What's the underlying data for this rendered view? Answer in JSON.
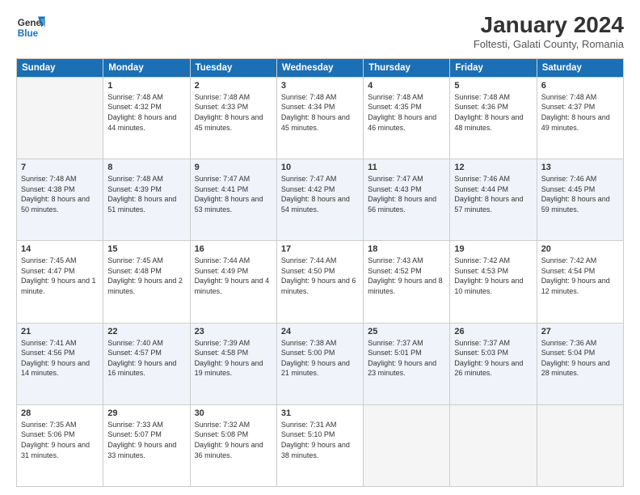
{
  "logo": {
    "line1": "General",
    "line2": "Blue"
  },
  "title": "January 2024",
  "subtitle": "Foltesti, Galati County, Romania",
  "header": {
    "days": [
      "Sunday",
      "Monday",
      "Tuesday",
      "Wednesday",
      "Thursday",
      "Friday",
      "Saturday"
    ]
  },
  "weeks": [
    [
      {
        "num": "",
        "empty": true
      },
      {
        "num": "1",
        "sunrise": "7:48 AM",
        "sunset": "4:32 PM",
        "daylight": "8 hours and 44 minutes."
      },
      {
        "num": "2",
        "sunrise": "7:48 AM",
        "sunset": "4:33 PM",
        "daylight": "8 hours and 45 minutes."
      },
      {
        "num": "3",
        "sunrise": "7:48 AM",
        "sunset": "4:34 PM",
        "daylight": "8 hours and 45 minutes."
      },
      {
        "num": "4",
        "sunrise": "7:48 AM",
        "sunset": "4:35 PM",
        "daylight": "8 hours and 46 minutes."
      },
      {
        "num": "5",
        "sunrise": "7:48 AM",
        "sunset": "4:36 PM",
        "daylight": "8 hours and 48 minutes."
      },
      {
        "num": "6",
        "sunrise": "7:48 AM",
        "sunset": "4:37 PM",
        "daylight": "8 hours and 49 minutes."
      }
    ],
    [
      {
        "num": "7",
        "sunrise": "7:48 AM",
        "sunset": "4:38 PM",
        "daylight": "8 hours and 50 minutes."
      },
      {
        "num": "8",
        "sunrise": "7:48 AM",
        "sunset": "4:39 PM",
        "daylight": "8 hours and 51 minutes."
      },
      {
        "num": "9",
        "sunrise": "7:47 AM",
        "sunset": "4:41 PM",
        "daylight": "8 hours and 53 minutes."
      },
      {
        "num": "10",
        "sunrise": "7:47 AM",
        "sunset": "4:42 PM",
        "daylight": "8 hours and 54 minutes."
      },
      {
        "num": "11",
        "sunrise": "7:47 AM",
        "sunset": "4:43 PM",
        "daylight": "8 hours and 56 minutes."
      },
      {
        "num": "12",
        "sunrise": "7:46 AM",
        "sunset": "4:44 PM",
        "daylight": "8 hours and 57 minutes."
      },
      {
        "num": "13",
        "sunrise": "7:46 AM",
        "sunset": "4:45 PM",
        "daylight": "8 hours and 59 minutes."
      }
    ],
    [
      {
        "num": "14",
        "sunrise": "7:45 AM",
        "sunset": "4:47 PM",
        "daylight": "9 hours and 1 minute."
      },
      {
        "num": "15",
        "sunrise": "7:45 AM",
        "sunset": "4:48 PM",
        "daylight": "9 hours and 2 minutes."
      },
      {
        "num": "16",
        "sunrise": "7:44 AM",
        "sunset": "4:49 PM",
        "daylight": "9 hours and 4 minutes."
      },
      {
        "num": "17",
        "sunrise": "7:44 AM",
        "sunset": "4:50 PM",
        "daylight": "9 hours and 6 minutes."
      },
      {
        "num": "18",
        "sunrise": "7:43 AM",
        "sunset": "4:52 PM",
        "daylight": "9 hours and 8 minutes."
      },
      {
        "num": "19",
        "sunrise": "7:42 AM",
        "sunset": "4:53 PM",
        "daylight": "9 hours and 10 minutes."
      },
      {
        "num": "20",
        "sunrise": "7:42 AM",
        "sunset": "4:54 PM",
        "daylight": "9 hours and 12 minutes."
      }
    ],
    [
      {
        "num": "21",
        "sunrise": "7:41 AM",
        "sunset": "4:56 PM",
        "daylight": "9 hours and 14 minutes."
      },
      {
        "num": "22",
        "sunrise": "7:40 AM",
        "sunset": "4:57 PM",
        "daylight": "9 hours and 16 minutes."
      },
      {
        "num": "23",
        "sunrise": "7:39 AM",
        "sunset": "4:58 PM",
        "daylight": "9 hours and 19 minutes."
      },
      {
        "num": "24",
        "sunrise": "7:38 AM",
        "sunset": "5:00 PM",
        "daylight": "9 hours and 21 minutes."
      },
      {
        "num": "25",
        "sunrise": "7:37 AM",
        "sunset": "5:01 PM",
        "daylight": "9 hours and 23 minutes."
      },
      {
        "num": "26",
        "sunrise": "7:37 AM",
        "sunset": "5:03 PM",
        "daylight": "9 hours and 26 minutes."
      },
      {
        "num": "27",
        "sunrise": "7:36 AM",
        "sunset": "5:04 PM",
        "daylight": "9 hours and 28 minutes."
      }
    ],
    [
      {
        "num": "28",
        "sunrise": "7:35 AM",
        "sunset": "5:06 PM",
        "daylight": "9 hours and 31 minutes."
      },
      {
        "num": "29",
        "sunrise": "7:33 AM",
        "sunset": "5:07 PM",
        "daylight": "9 hours and 33 minutes."
      },
      {
        "num": "30",
        "sunrise": "7:32 AM",
        "sunset": "5:08 PM",
        "daylight": "9 hours and 36 minutes."
      },
      {
        "num": "31",
        "sunrise": "7:31 AM",
        "sunset": "5:10 PM",
        "daylight": "9 hours and 38 minutes."
      },
      {
        "num": "",
        "empty": true
      },
      {
        "num": "",
        "empty": true
      },
      {
        "num": "",
        "empty": true
      }
    ]
  ]
}
